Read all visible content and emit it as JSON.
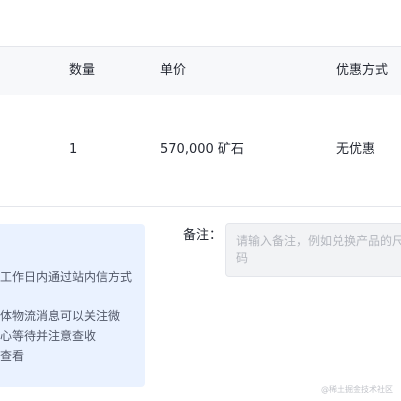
{
  "table": {
    "headers": {
      "quantity": "数量",
      "unit_price": "单价",
      "discount": "优惠方式"
    },
    "rows": [
      {
        "quantity": "1",
        "unit_price": "570,000 矿石",
        "discount": "无优惠"
      }
    ]
  },
  "notice": {
    "lines": [
      "工作日内通过站内信方式",
      "体物流消息可以关注微",
      "心等待并注意查收",
      "查看"
    ]
  },
  "remark": {
    "label": "备注：",
    "placeholder": "请输入备注，例如兑换产品的尺码",
    "value": ""
  },
  "watermark": "@稀土掘金技术社区"
}
